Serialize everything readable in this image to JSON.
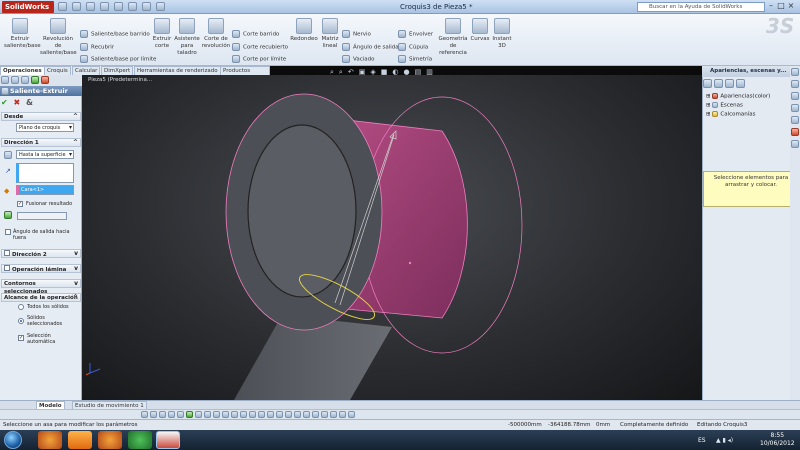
{
  "app": {
    "name": "SolidWorks",
    "title": "Croquis3 de Pieza5 *",
    "help_placeholder": "Buscar en la Ayuda de SolidWorks"
  },
  "ribbon": {
    "extrude": "Extruir saliente/base",
    "revolve": "Revolución de saliente/base",
    "sweep": "Saliente/base barrido",
    "loft": "Recubrir",
    "boundary": "Saliente/base por límite",
    "extruded_cut": "Extruir corte",
    "hole_wizard": "Asistente para taladro",
    "revolved_cut": "Corte de revolución",
    "swept_cut": "Corte barrido",
    "lofted_cut": "Corte recubierto",
    "boundary_cut": "Corte por límite",
    "fillet": "Redondeo",
    "linear_pattern": "Matriz lineal",
    "rib": "Nervio",
    "draft": "Ángulo de salida",
    "shell": "Vaciado",
    "wrap": "Envolver",
    "dome": "Cúpula",
    "mirror": "Simetría",
    "ref_geometry": "Geometría de referencia",
    "curves": "Curvas",
    "instant3d": "Instant 3D"
  },
  "tabs": [
    "Operaciones",
    "Croquis",
    "Calcular",
    "DimXpert",
    "Herramientas de renderizado",
    "Productos Office"
  ],
  "tree_item": "Pieza5 (Predetermina...",
  "pm": {
    "title": "Saliente-Extruir",
    "desde": "Desde",
    "plano": "Plano de croquis",
    "dir1": "Dirección 1",
    "hasta": "Hasta la superficie",
    "cara": "Cara<1>",
    "fusionar": "Fusionar resultado",
    "angulo": "Ángulo de salida hacia fuera",
    "dir2": "Dirección 2",
    "lamina": "Operación lámina",
    "contornos": "Contornos seleccionados",
    "alcance": "Alcance de la operación",
    "todos": "Todos los sólidos",
    "seleccionados": "Sólidos seleccionados",
    "auto": "Selección automática"
  },
  "right": {
    "title": "Apariencias, escenas y...",
    "items": [
      "Apariencias(color)",
      "Escenas",
      "Calcomanías"
    ],
    "message": "Seleccione elementos para arrastrar y colocar."
  },
  "bottom_tabs": [
    "Modelo",
    "Estudio de movimiento 1"
  ],
  "status": {
    "hint": "Seleccione un asa para modificar los parámetros",
    "x": "-500000mm",
    "y": "-364188.78mm",
    "z": "0mm",
    "state": "Completamente definido",
    "editing": "Editando Croquis3"
  },
  "taskbar": {
    "lang": "ES",
    "time": "8:55",
    "date": "10/06/2012"
  },
  "colors": {
    "accent": "#cc2b1e",
    "selection": "#e06aa6",
    "highlight": "#3fa7f0"
  }
}
